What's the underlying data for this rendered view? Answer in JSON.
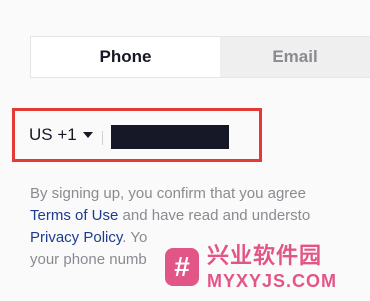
{
  "tabs": {
    "phone": "Phone",
    "email": "Email"
  },
  "phone_input": {
    "country_code": "US +1"
  },
  "legal": {
    "line1": "By signing up, you confirm that you agree",
    "terms_link": "Terms of Use",
    "line2_rest": " and have read and understo",
    "privacy_link": "Privacy Policy",
    "line3_rest": ". Yo",
    "line4": "your phone numb"
  },
  "watermark": {
    "logo_glyph": "#",
    "chinese": "兴业软件园",
    "english": "MYXYJS.COM"
  },
  "colors": {
    "highlight_border": "#e53935",
    "link": "#1d3c8e",
    "watermark": "#e0457b"
  }
}
